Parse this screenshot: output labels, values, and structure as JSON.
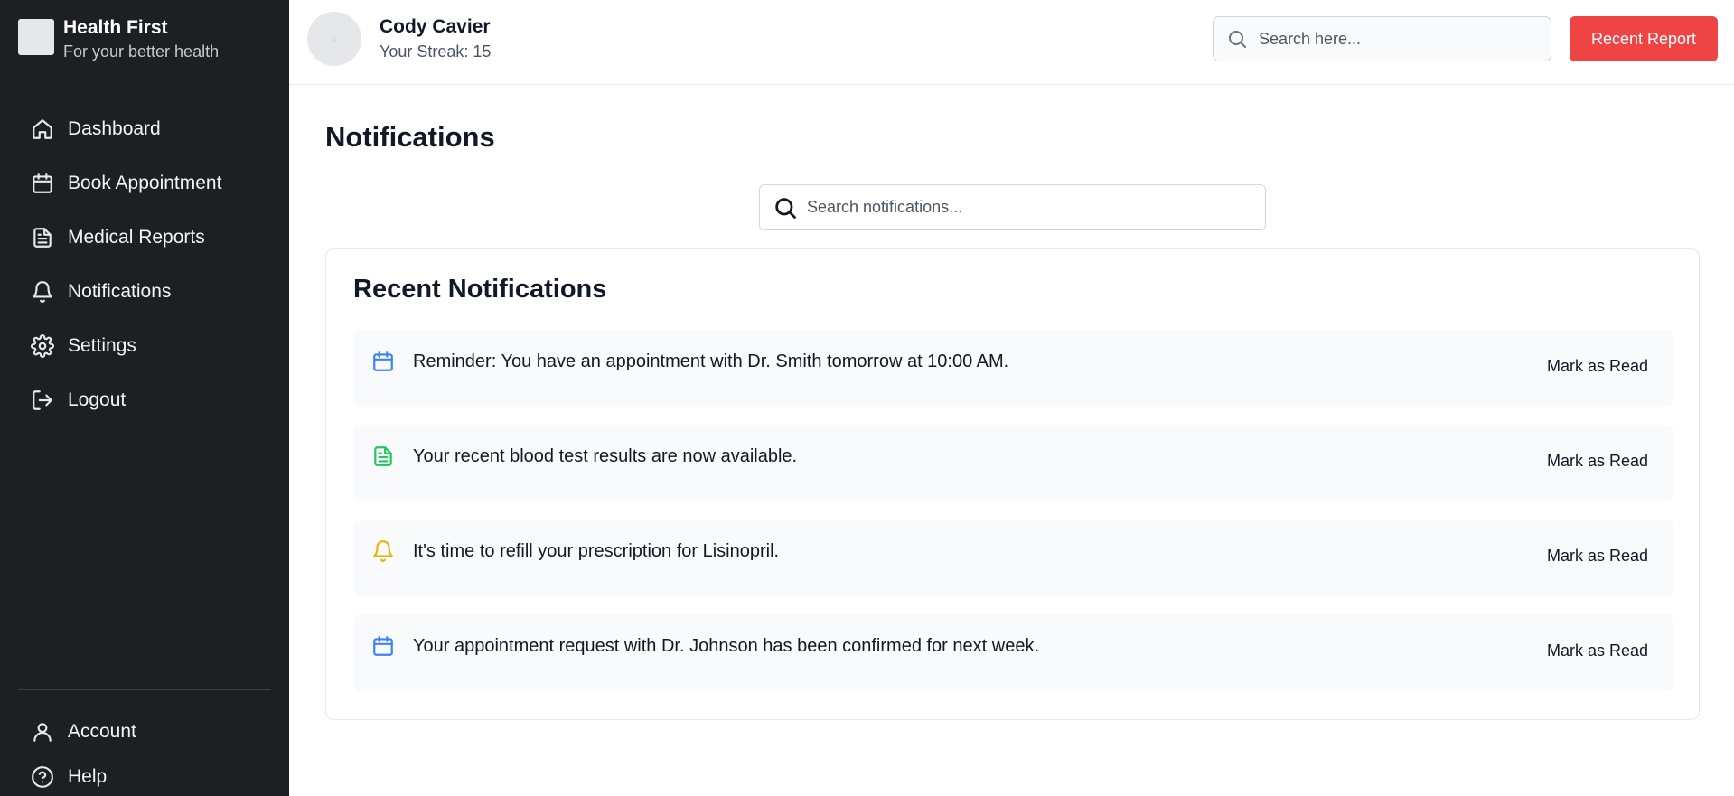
{
  "brand": {
    "name": "Health First",
    "tagline": "For your better health"
  },
  "sidebar": {
    "items": [
      {
        "label": "Dashboard",
        "icon": "home-icon"
      },
      {
        "label": "Book Appointment",
        "icon": "calendar-icon"
      },
      {
        "label": "Medical Reports",
        "icon": "file-text-icon"
      },
      {
        "label": "Notifications",
        "icon": "bell-icon"
      },
      {
        "label": "Settings",
        "icon": "gear-icon"
      },
      {
        "label": "Logout",
        "icon": "logout-icon"
      }
    ],
    "bottom_items": [
      {
        "label": "Account",
        "icon": "user-icon"
      },
      {
        "label": "Help",
        "icon": "help-circle-icon"
      }
    ]
  },
  "header": {
    "user_name": "Cody Cavier",
    "streak": "Your Streak: 15",
    "search_placeholder": "Search here...",
    "report_button": "Recent Report"
  },
  "main": {
    "title": "Notifications",
    "search_placeholder": "Search notifications...",
    "card_title": "Recent Notifications",
    "notifications": [
      {
        "text": "Reminder: You have an appointment with Dr. Smith tomorrow at 10:00 AM.",
        "icon": "calendar-icon",
        "color": "#3b82f6",
        "action": "Mark as Read"
      },
      {
        "text": "Your recent blood test results are now available.",
        "icon": "file-text-icon",
        "color": "#22c55e",
        "action": "Mark as Read"
      },
      {
        "text": "It's time to refill your prescription for Lisinopril.",
        "icon": "bell-icon",
        "color": "#eab308",
        "action": "Mark as Read"
      },
      {
        "text": "Your appointment request with Dr. Johnson has been confirmed for next week.",
        "icon": "calendar-icon",
        "color": "#3b82f6",
        "action": "Mark as Read"
      }
    ]
  },
  "colors": {
    "sidebar_bg": "#1d1f23",
    "accent_red": "#ef4444"
  }
}
